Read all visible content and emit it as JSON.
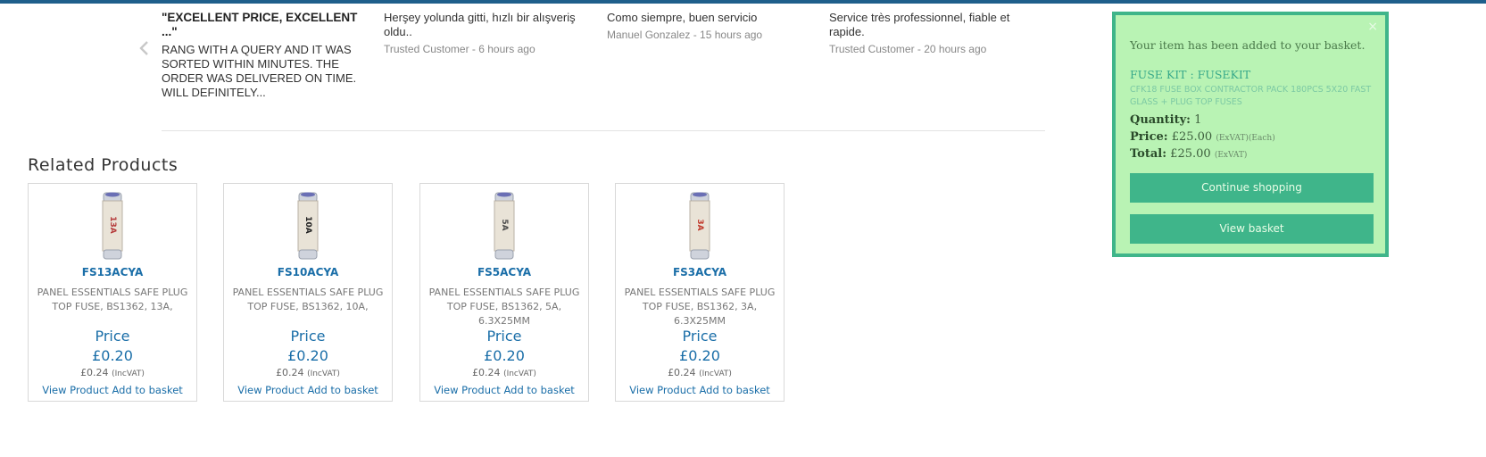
{
  "reviews": [
    {
      "title": "\"EXCELLENT PRICE, EXCELLENT ...\"",
      "body": "RANG WITH A QUERY AND IT WAS SORTED WITHIN MINUTES. THE ORDER WAS DELIVERED ON TIME. WILL DEFINITELY...",
      "meta": ""
    },
    {
      "title": "",
      "body": "Herşey yolunda gitti, hızlı bir alışveriş oldu..",
      "meta": "Trusted Customer - 6 hours ago"
    },
    {
      "title": "",
      "body": "Como siempre, buen servicio",
      "meta": "Manuel Gonzalez - 15 hours ago"
    },
    {
      "title": "",
      "body": "Service très professionnel, fiable et rapide.",
      "meta": "Trusted Customer - 20 hours ago"
    }
  ],
  "related": {
    "title": "Related Products",
    "products": [
      {
        "sku": "FS13ACYA",
        "desc": "PANEL ESSENTIALS SAFE PLUG TOP FUSE, BS1362, 13A,",
        "price_label": "Price",
        "price": "£0.20",
        "incvat": "£0.24",
        "incvat_tag": "(IncVAT)",
        "view": "View Product",
        "add": "Add to basket",
        "fuse_color": "#b53a3a",
        "fuse_text": "13A"
      },
      {
        "sku": "FS10ACYA",
        "desc": "PANEL ESSENTIALS SAFE PLUG TOP FUSE, BS1362, 10A,",
        "price_label": "Price",
        "price": "£0.20",
        "incvat": "£0.24",
        "incvat_tag": "(IncVAT)",
        "view": "View Product",
        "add": "Add to basket",
        "fuse_color": "#222222",
        "fuse_text": "10A"
      },
      {
        "sku": "FS5ACYA",
        "desc": "PANEL ESSENTIALS SAFE PLUG TOP FUSE, BS1362, 5A, 6.3X25MM",
        "price_label": "Price",
        "price": "£0.20",
        "incvat": "£0.24",
        "incvat_tag": "(IncVAT)",
        "view": "View Product",
        "add": "Add to basket",
        "fuse_color": "#4a4a4a",
        "fuse_text": "5A"
      },
      {
        "sku": "FS3ACYA",
        "desc": "PANEL ESSENTIALS SAFE PLUG TOP FUSE, BS1362, 3A, 6.3X25MM",
        "price_label": "Price",
        "price": "£0.20",
        "incvat": "£0.24",
        "incvat_tag": "(IncVAT)",
        "view": "View Product",
        "add": "Add to basket",
        "fuse_color": "#c0392b",
        "fuse_text": "3A"
      }
    ]
  },
  "basket": {
    "close": "×",
    "message": "Your item has been added to your basket.",
    "product_name": "FUSE KIT : FUSEKIT",
    "product_desc": "CFK18 FUSE BOX CONTRACTOR PACK 180PCS 5X20 FAST GLASS + PLUG TOP FUSES",
    "quantity_label": "Quantity:",
    "quantity": "1",
    "price_label": "Price:",
    "price": "£25.00",
    "price_note": "(ExVAT)(Each)",
    "total_label": "Total:",
    "total": "£25.00",
    "total_note": "(ExVAT)",
    "continue_label": "Continue shopping",
    "view_label": "View basket"
  },
  "colors": {
    "accent": "#1a6ea8",
    "notify_bg": "#b9f3b4",
    "notify_border": "#3fb58a"
  },
  "icons": {
    "prev": "chevron-left-icon",
    "next": "chevron-right-icon",
    "close": "close-icon"
  }
}
